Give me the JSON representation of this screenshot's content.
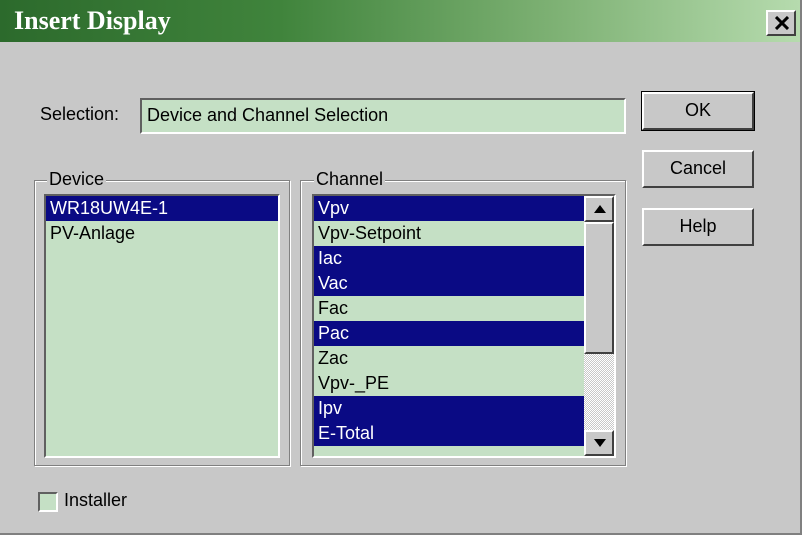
{
  "window": {
    "title": "Insert Display"
  },
  "selection": {
    "label": "Selection:",
    "value": "Device and Channel Selection"
  },
  "buttons": {
    "ok": "OK",
    "cancel": "Cancel",
    "help": "Help"
  },
  "device": {
    "legend": "Device",
    "items": [
      {
        "label": "WR18UW4E-1",
        "selected": true
      },
      {
        "label": "PV-Anlage",
        "selected": false
      }
    ]
  },
  "channel": {
    "legend": "Channel",
    "items": [
      {
        "label": "Vpv",
        "selected": true
      },
      {
        "label": "Vpv-Setpoint",
        "selected": false
      },
      {
        "label": "Iac",
        "selected": true
      },
      {
        "label": "Vac",
        "selected": true
      },
      {
        "label": "Fac",
        "selected": false
      },
      {
        "label": "Pac",
        "selected": true
      },
      {
        "label": "Zac",
        "selected": false
      },
      {
        "label": "Vpv-_PE",
        "selected": false
      },
      {
        "label": "Ipv",
        "selected": true
      },
      {
        "label": "E-Total",
        "selected": true
      }
    ]
  },
  "installer": {
    "label": "Installer",
    "checked": false
  },
  "colors": {
    "selection_bg": "#0a0a84",
    "field_bg": "#c5e0c5",
    "dialog_bg": "#c8c8c8"
  },
  "icons": {
    "close": "close-icon",
    "scroll_up": "arrow-up-icon",
    "scroll_down": "arrow-down-icon"
  }
}
